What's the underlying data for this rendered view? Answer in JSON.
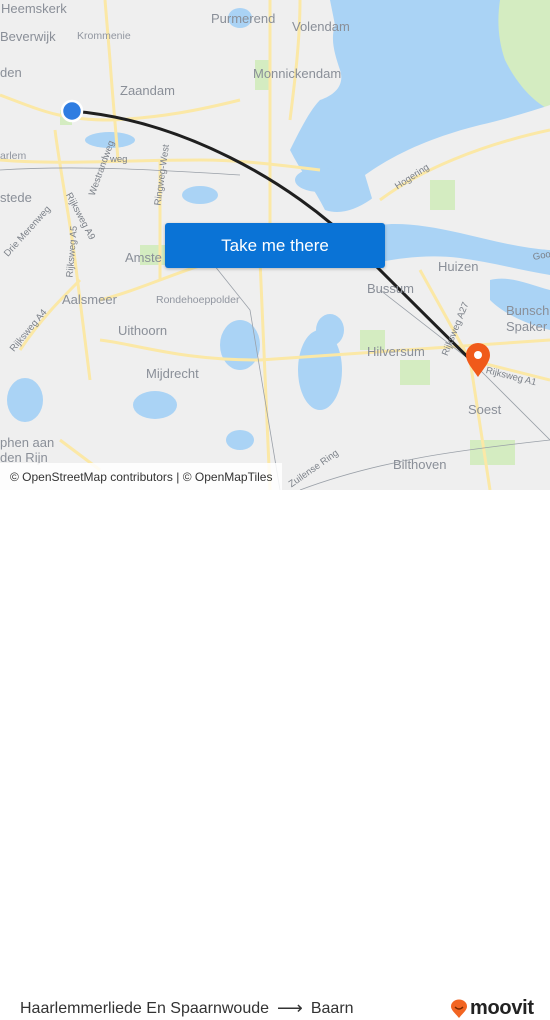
{
  "map": {
    "places": [
      {
        "id": "heemskerk",
        "name": "Heemskerk",
        "size": "large"
      },
      {
        "id": "beverwijk",
        "name": "Beverwijk",
        "size": "large"
      },
      {
        "id": "krommenie",
        "name": "Krommenie",
        "size": "small"
      },
      {
        "id": "ijmuiden",
        "name": "den",
        "size": "large"
      },
      {
        "id": "zaandam",
        "name": "Zaandam",
        "size": "large"
      },
      {
        "id": "purmerend",
        "name": "Purmerend",
        "size": "large"
      },
      {
        "id": "volendam",
        "name": "Volendam",
        "size": "large"
      },
      {
        "id": "monnickendam",
        "name": "Monnickendam",
        "size": "large"
      },
      {
        "id": "haarlem",
        "name": "arlem",
        "size": "large"
      },
      {
        "id": "heemstede",
        "name": "stede",
        "size": "large"
      },
      {
        "id": "amsterdam",
        "name": "Amste",
        "size": "large"
      },
      {
        "id": "aalsmeer",
        "name": "Aalsmeer",
        "size": "large"
      },
      {
        "id": "rondehoeppolder",
        "name": "Rondehoeppolder",
        "size": "small"
      },
      {
        "id": "uithoorn",
        "name": "Uithoorn",
        "size": "large"
      },
      {
        "id": "mijdrecht",
        "name": "Mijdrecht",
        "size": "large"
      },
      {
        "id": "alphen-1",
        "name": "phen aan",
        "size": "large"
      },
      {
        "id": "alphen-2",
        "name": "den Rijn",
        "size": "large"
      },
      {
        "id": "huizen",
        "name": "Huizen",
        "size": "large"
      },
      {
        "id": "bussum",
        "name": "Bussum",
        "size": "large"
      },
      {
        "id": "bunschoten-1",
        "name": "Bunsch",
        "size": "large"
      },
      {
        "id": "bunschoten-2",
        "name": "Spaker",
        "size": "large"
      },
      {
        "id": "hilversum",
        "name": "Hilversum",
        "size": "large"
      },
      {
        "id": "soest",
        "name": "Soest",
        "size": "large"
      },
      {
        "id": "bilthoven",
        "name": "Bilthoven",
        "size": "large"
      }
    ],
    "roads": [
      {
        "id": "westrandweg",
        "name": "Westrandweg"
      },
      {
        "id": "a10-west",
        "name": "weg"
      },
      {
        "id": "ringweg-west",
        "name": "Ringweg-West"
      },
      {
        "id": "a9",
        "name": "Rijksweg A9"
      },
      {
        "id": "a5",
        "name": "Rijksweg A5"
      },
      {
        "id": "drie-merenweg",
        "name": "Drie Merenweg"
      },
      {
        "id": "a4",
        "name": "Rijksweg A4"
      },
      {
        "id": "hogering",
        "name": "Hogering"
      },
      {
        "id": "a27",
        "name": "Rijksweg A27"
      },
      {
        "id": "a1",
        "name": "Rijksweg A1"
      },
      {
        "id": "zuilense-ring",
        "name": "Zuilense Ring"
      },
      {
        "id": "gooi",
        "name": "Goo"
      },
      {
        "id": "go",
        "name": "Go"
      }
    ],
    "origin_marker": {
      "label": "Haarlemmerliede En Spaarnwoude",
      "color": "#2f7de1"
    },
    "destination_marker": {
      "label": "Baarn",
      "color": "#f05a1a"
    },
    "route_color": "#1f1f1f",
    "water_color": "#aad3f5",
    "land_color": "#efefef"
  },
  "cta": {
    "label": "Take me there",
    "color": "#0a73d6"
  },
  "attribution": "© OpenStreetMap contributors | © OpenMapTiles",
  "footer": {
    "origin": "Haarlemmerliede En Spaarnwoude",
    "arrow": "⟶",
    "destination": "Baarn",
    "brand": "moovit",
    "brand_color": "#f26522"
  }
}
